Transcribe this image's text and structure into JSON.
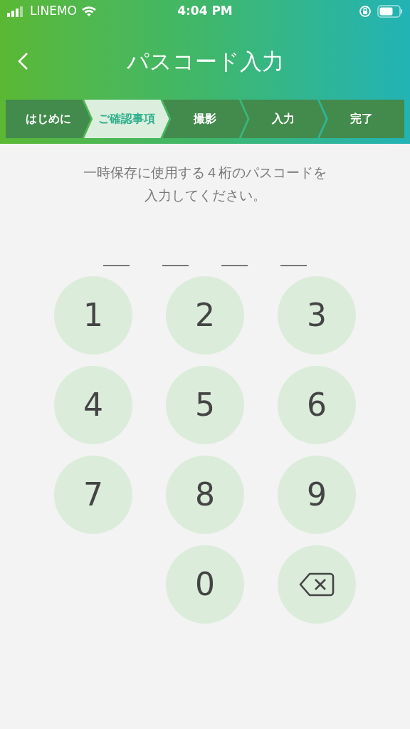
{
  "status_bar": {
    "carrier": "LINEMO",
    "time": "4:04 PM"
  },
  "header": {
    "title": "パスコード入力"
  },
  "steps": [
    {
      "label": "はじめに",
      "selected": false
    },
    {
      "label": "ご確認事項",
      "selected": true
    },
    {
      "label": "撮影",
      "selected": false
    },
    {
      "label": "入力",
      "selected": false
    },
    {
      "label": "完了",
      "selected": false
    }
  ],
  "instruction": [
    "一時保存に使用する４桁のパスコードを",
    "入力してください。"
  ],
  "code_slots": [
    {
      "filled": false
    },
    {
      "filled": false
    },
    {
      "filled": false
    },
    {
      "filled": false
    }
  ],
  "keypad": [
    {
      "kind": "digit",
      "label": "1"
    },
    {
      "kind": "digit",
      "label": "2"
    },
    {
      "kind": "digit",
      "label": "3"
    },
    {
      "kind": "digit",
      "label": "4"
    },
    {
      "kind": "digit",
      "label": "5"
    },
    {
      "kind": "digit",
      "label": "6"
    },
    {
      "kind": "digit",
      "label": "7"
    },
    {
      "kind": "digit",
      "label": "8"
    },
    {
      "kind": "digit",
      "label": "9"
    },
    {
      "kind": "digit",
      "label": "0"
    },
    {
      "kind": "delete"
    }
  ]
}
